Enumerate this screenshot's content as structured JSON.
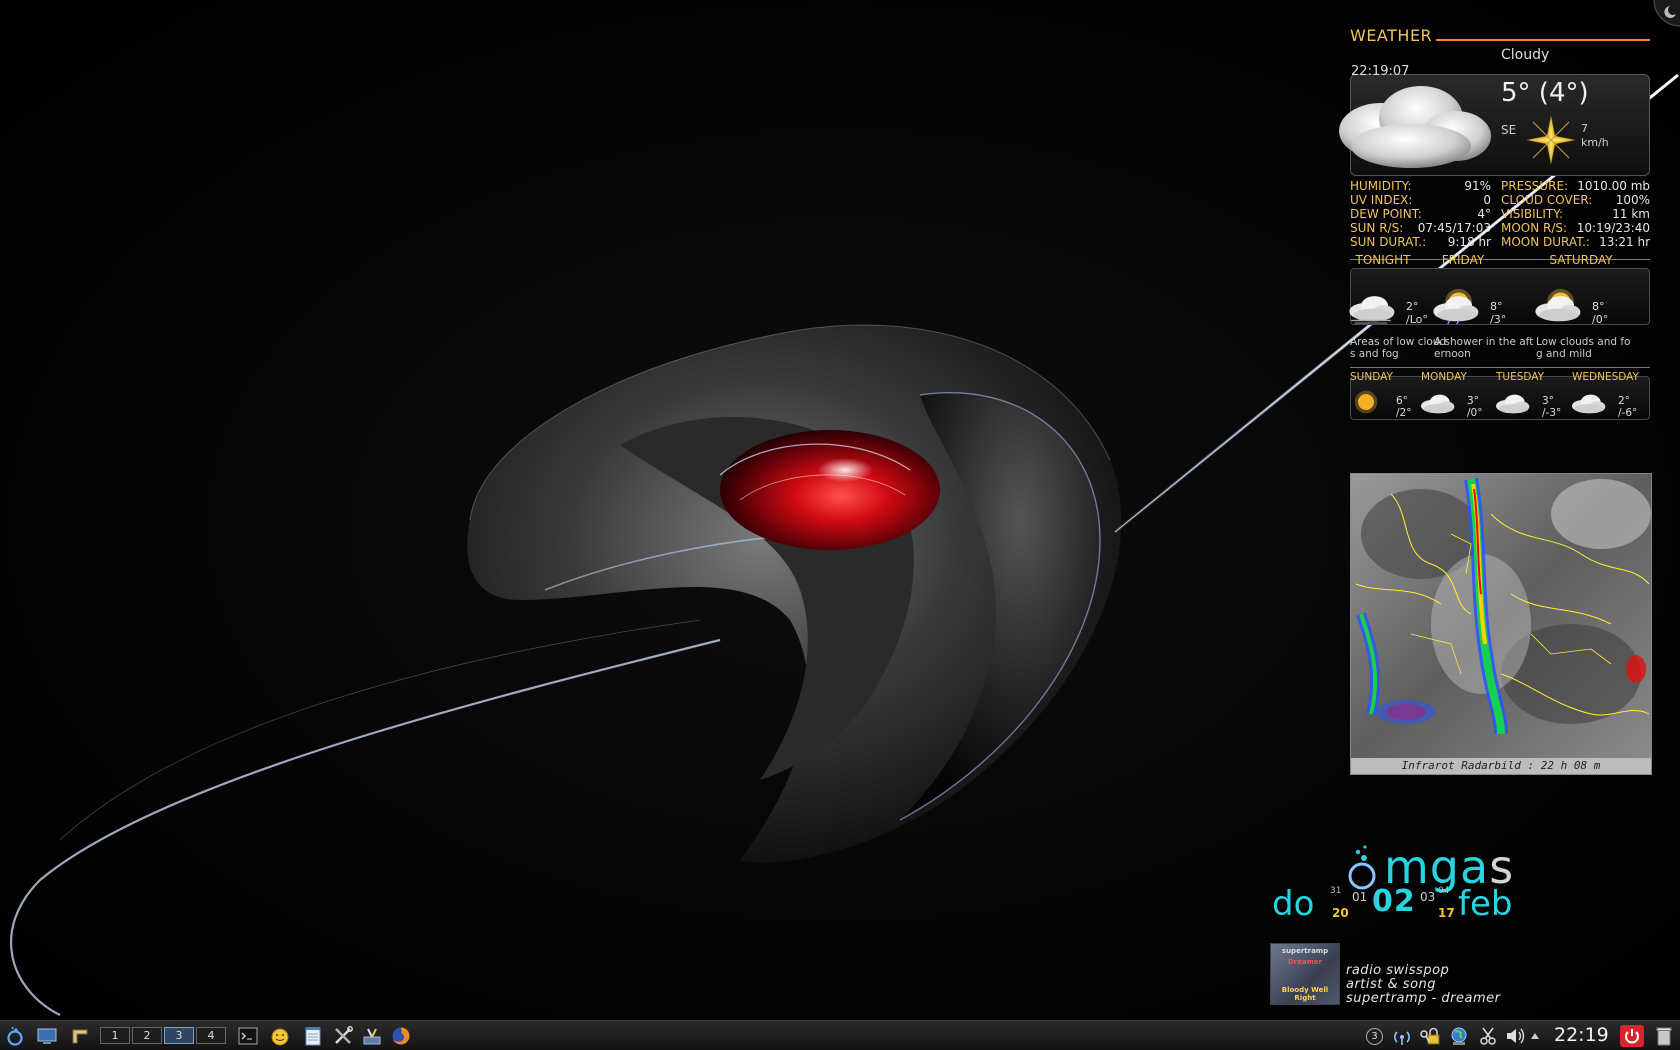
{
  "weather": {
    "title": "WEATHER",
    "condition": "Cloudy",
    "time": "22:19:07",
    "temperature": "5° (4°)",
    "wind_dir": "SE",
    "wind_speed": "7",
    "wind_unit": "km/h",
    "details_left": [
      {
        "key": "HUMIDITY:",
        "value": "91%"
      },
      {
        "key": "UV INDEX:",
        "value": "0"
      },
      {
        "key": "DEW POINT:",
        "value": "4°"
      },
      {
        "key": "SUN R/S:",
        "value": "07:45/17:03"
      },
      {
        "key": "SUN DURAT.:",
        "value": "9:18 hr"
      }
    ],
    "details_right": [
      {
        "key": "PRESSURE:",
        "value": "1010.00 mb"
      },
      {
        "key": "CLOUD COVER:",
        "value": "100%"
      },
      {
        "key": "VISIBILITY:",
        "value": "11 km"
      },
      {
        "key": "MOON R/S:",
        "value": "10:19/23:40"
      },
      {
        "key": "MOON DURAT.:",
        "value": "13:21 hr"
      }
    ],
    "forecast": [
      {
        "day": "TONIGHT",
        "hi": "2°",
        "lo": "/Lo°",
        "desc": "Areas of low clouds and fog",
        "icon": "cloud-fog-icon"
      },
      {
        "day": "FRIDAY",
        "hi": "8°",
        "lo": "/3°",
        "desc": "A shower in the afternoon",
        "icon": "sun-cloud-rain-icon"
      },
      {
        "day": "SATURDAY",
        "hi": "8°",
        "lo": "/0°",
        "desc": "Low clouds and fog and mild",
        "icon": "sun-cloud-icon"
      }
    ],
    "extended": [
      {
        "day": "SUNDAY",
        "hi": "6°",
        "lo": "/2°",
        "icon": "sun-icon"
      },
      {
        "day": "MONDAY",
        "hi": "3°",
        "lo": "/0°",
        "icon": "cloud-icon"
      },
      {
        "day": "TUESDAY",
        "hi": "3°",
        "lo": "/-3°",
        "icon": "cloud-icon"
      },
      {
        "day": "WEDNESDAY",
        "hi": "2°",
        "lo": "/-6°",
        "icon": "cloud-icon"
      }
    ]
  },
  "radar": {
    "caption": "Infrarot Radarbild :  22 h 08 m"
  },
  "clock": {
    "logo": "mga",
    "logo_tail": "s",
    "weekday": "do",
    "year_a": "20",
    "year_b": "17",
    "day_prev_a": "31",
    "day_prev_b": "01",
    "day": "02",
    "day_next_a": "03",
    "day_next_b": "04",
    "month": "feb"
  },
  "radio": {
    "cover_top": "supertramp",
    "cover_mid": "Dreamer",
    "cover_bottom": "Bloody Well Right",
    "station": "radio swisspop",
    "label": "artist & song",
    "track": "supertramp - dreamer"
  },
  "taskbar": {
    "pager": [
      "1",
      "2",
      "3",
      "4"
    ],
    "active_desktop": "3",
    "tray_badge": "3",
    "clock": "22:19"
  },
  "colors": {
    "accent_orange": "#f08a2a",
    "label_gold": "#f2c25c",
    "clock_cyan": "#27d4df",
    "power_red": "#d8242a"
  }
}
